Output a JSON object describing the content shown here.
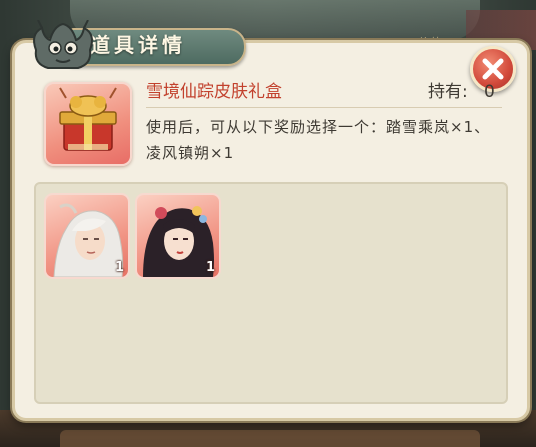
{
  "dialog": {
    "title": "道具详情",
    "close_icon": "close-icon"
  },
  "item": {
    "name": "雪境仙踪皮肤礼盒",
    "held_label": "持有:",
    "held_count": "0",
    "description": "使用后，可从以下奖励选择一个：踏雪乘岚×1、凌风镇朔×1",
    "icon": "gift-box-icon"
  },
  "rewards": [
    {
      "icon": "white-haired-character-portrait",
      "count": "1"
    },
    {
      "icon": "black-haired-character-portrait",
      "count": "1"
    }
  ],
  "background": {
    "price_text": "价值"
  },
  "colors": {
    "accent_red": "#c2412d",
    "panel_bg": "#f4efe2",
    "header_green": "#5c7a6e",
    "close_red": "#d24a3b"
  }
}
